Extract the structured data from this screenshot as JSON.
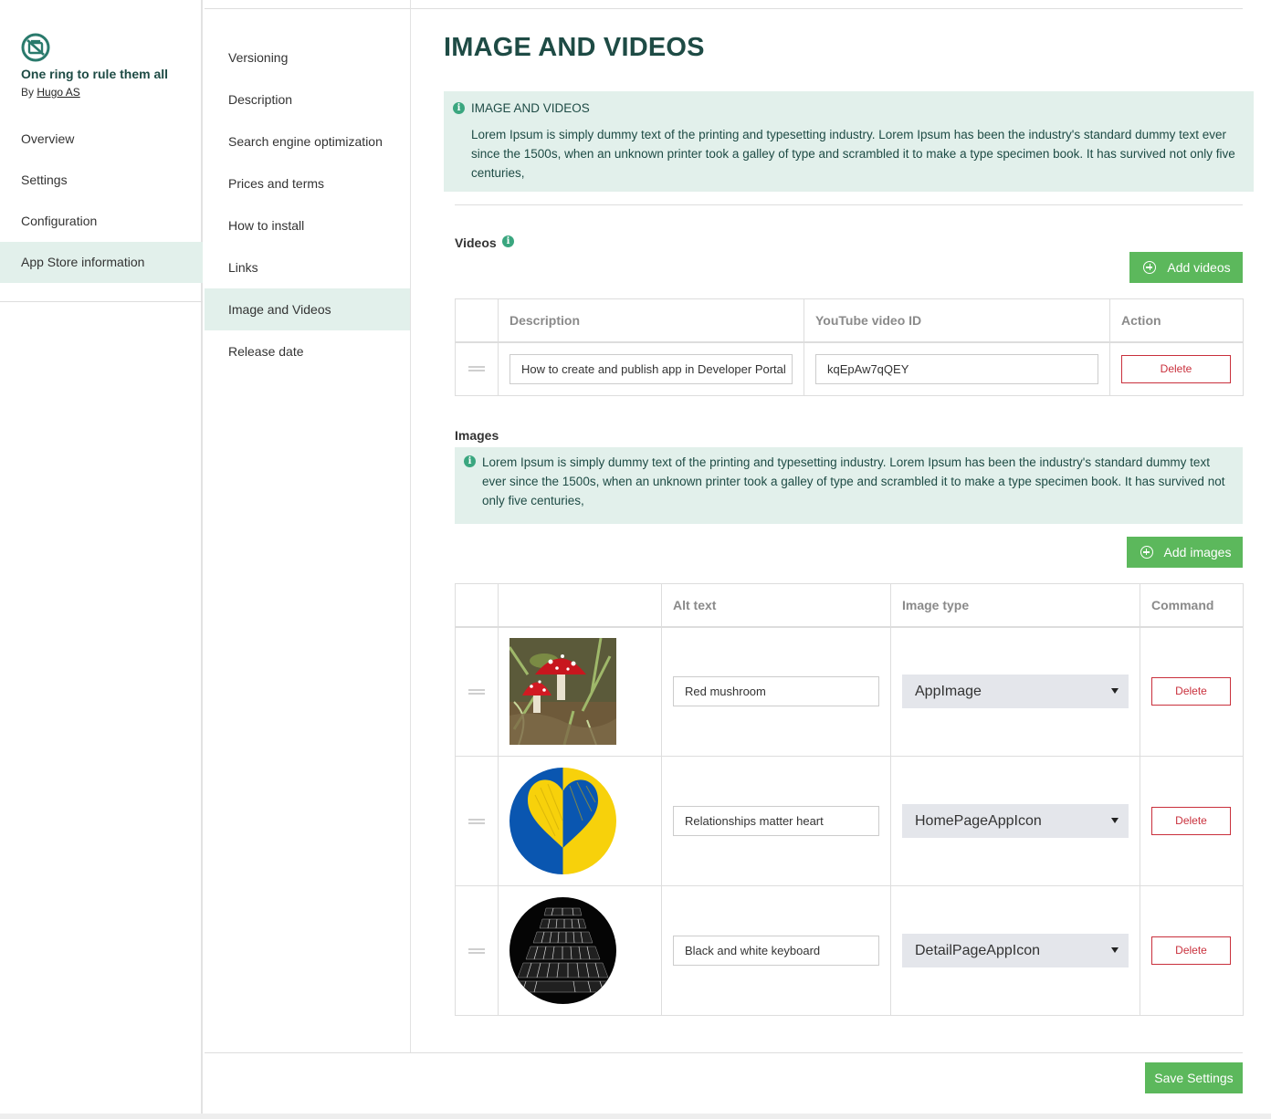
{
  "app": {
    "title": "One ring to rule them all",
    "by_prefix": "By",
    "vendor": "Hugo AS"
  },
  "app_nav": [
    {
      "label": "Overview",
      "active": false
    },
    {
      "label": "Settings",
      "active": false
    },
    {
      "label": "Configuration",
      "active": false
    },
    {
      "label": "App Store information",
      "active": true
    }
  ],
  "sub_nav": [
    {
      "label": "Versioning",
      "active": false
    },
    {
      "label": "Description",
      "active": false
    },
    {
      "label": "Search engine optimization",
      "active": false
    },
    {
      "label": "Prices and terms",
      "active": false
    },
    {
      "label": "How to install",
      "active": false
    },
    {
      "label": "Links",
      "active": false
    },
    {
      "label": "Image and Videos",
      "active": true
    },
    {
      "label": "Release date",
      "active": false
    }
  ],
  "page": {
    "title": "IMAGE AND VIDEOS",
    "info_heading": "IMAGE AND VIDEOS",
    "info_text": "Lorem Ipsum is simply dummy text of the printing and typesetting industry. Lorem Ipsum has been the industry's standard dummy text ever since the 1500s, when an unknown printer took a galley of type and scrambled it to make a type specimen book. It has survived not only five centuries,"
  },
  "videos": {
    "label": "Videos",
    "add_button": "Add videos",
    "columns": {
      "description": "Description",
      "video_id": "YouTube video ID",
      "action": "Action"
    },
    "rows": [
      {
        "description": "How to create and publish app in Developer Portal",
        "video_id": "kqEpAw7qQEY",
        "delete_label": "Delete"
      }
    ]
  },
  "images": {
    "label": "Images",
    "info_text": "Lorem Ipsum is simply dummy text of the printing and typesetting industry. Lorem Ipsum has been the industry's standard dummy text ever since the 1500s, when an unknown printer took a galley of type and scrambled it to make a type specimen book. It has survived not only five centuries,",
    "add_button": "Add images",
    "columns": {
      "thumb": "",
      "alt_text": "Alt text",
      "image_type": "Image type",
      "command": "Command"
    },
    "rows": [
      {
        "alt_text": "Red mushroom",
        "image_type": "AppImage",
        "delete_label": "Delete",
        "thumbnail": "red-mushroom-photo"
      },
      {
        "alt_text": "Relationships matter heart",
        "image_type": "HomePageAppIcon",
        "delete_label": "Delete",
        "thumbnail": "heart-icon-blue-yellow"
      },
      {
        "alt_text": "Black and white keyboard",
        "image_type": "DetailPageAppIcon",
        "delete_label": "Delete",
        "thumbnail": "keyboard-photo"
      }
    ]
  },
  "footer": {
    "save_button": "Save Settings"
  },
  "colors": {
    "brand_dark": "#1e4b45",
    "info_bg": "#e2f0eb",
    "info_icon": "#3aa67f",
    "button_green": "#5cb85c",
    "delete_red": "#c9303c",
    "select_bg": "#e4e6eb"
  }
}
